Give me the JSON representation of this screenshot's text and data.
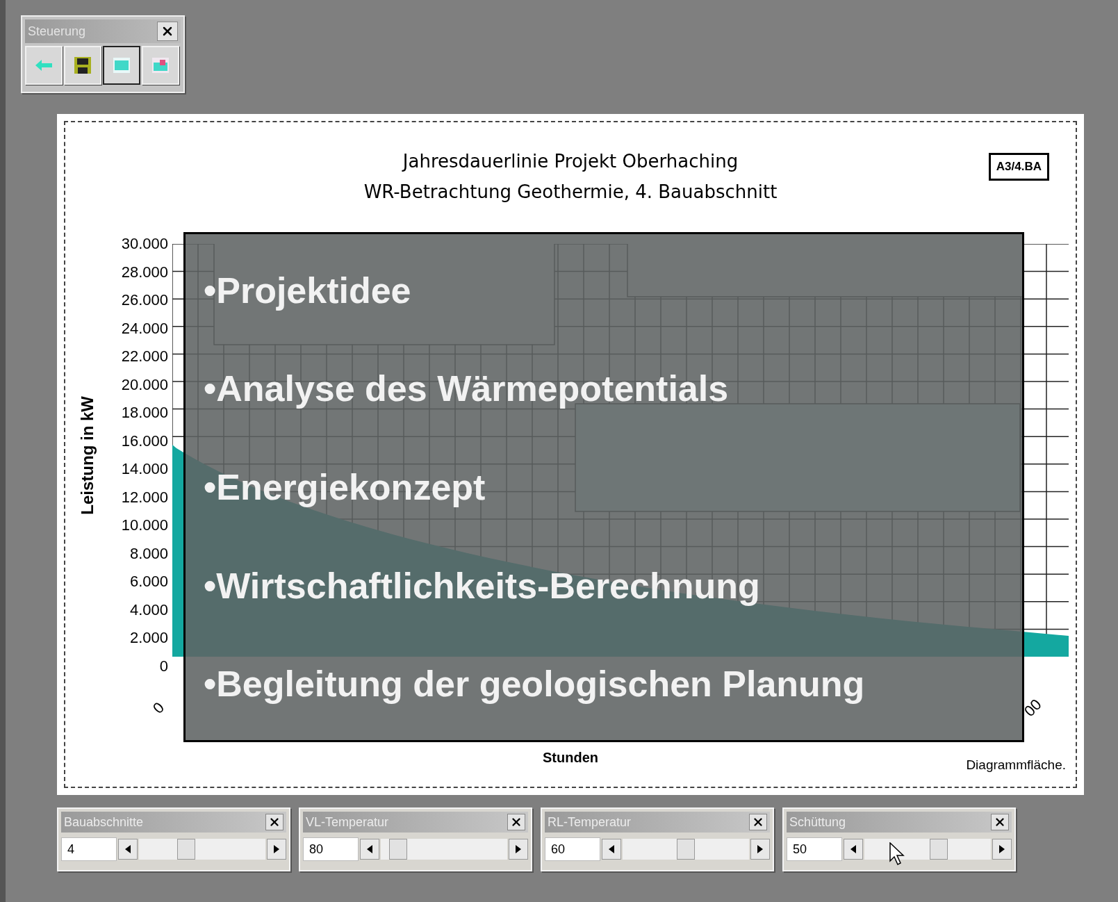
{
  "toolbar": {
    "title": "Steuerung",
    "buttons": [
      {
        "kind": "back",
        "pressed": false
      },
      {
        "kind": "save",
        "pressed": false
      },
      {
        "kind": "chart",
        "pressed": true
      },
      {
        "kind": "table",
        "pressed": false
      }
    ]
  },
  "chart": {
    "title": "Jahresdauerlinie Projekt Oberhaching",
    "subtitle": "WR-Betrachtung  Geothermie, 4. Bauabschnitt",
    "badge": "A3/4.BA",
    "ylabel": "Leistung in kW",
    "yticks": [
      "30.000",
      "28.000",
      "26.000",
      "24.000",
      "22.000",
      "20.000",
      "18.000",
      "16.000",
      "14.000",
      "12.000",
      "10.000",
      "8.000",
      "6.000",
      "4.000",
      "2.000",
      "0"
    ],
    "xticks": [
      "0",
      "00"
    ],
    "xlabel": "Stunden",
    "footer": "Diagrammfläche."
  },
  "overlay": {
    "items": [
      "•Projektidee",
      "•Analyse des Wärmepotentials",
      "•Energiekonzept",
      "•Wirtschaftlichkeits-Berechnung",
      "•Begleitung der geologischen Planung"
    ]
  },
  "panels": [
    {
      "title": "Bauabschnitte",
      "value": "4",
      "level": 0.35
    },
    {
      "title": "VL-Temperatur",
      "value": "80",
      "level": 0.08
    },
    {
      "title": "RL-Temperatur",
      "value": "60",
      "level": 0.5
    },
    {
      "title": "Schüttung",
      "value": "50",
      "level": 0.6
    }
  ]
}
